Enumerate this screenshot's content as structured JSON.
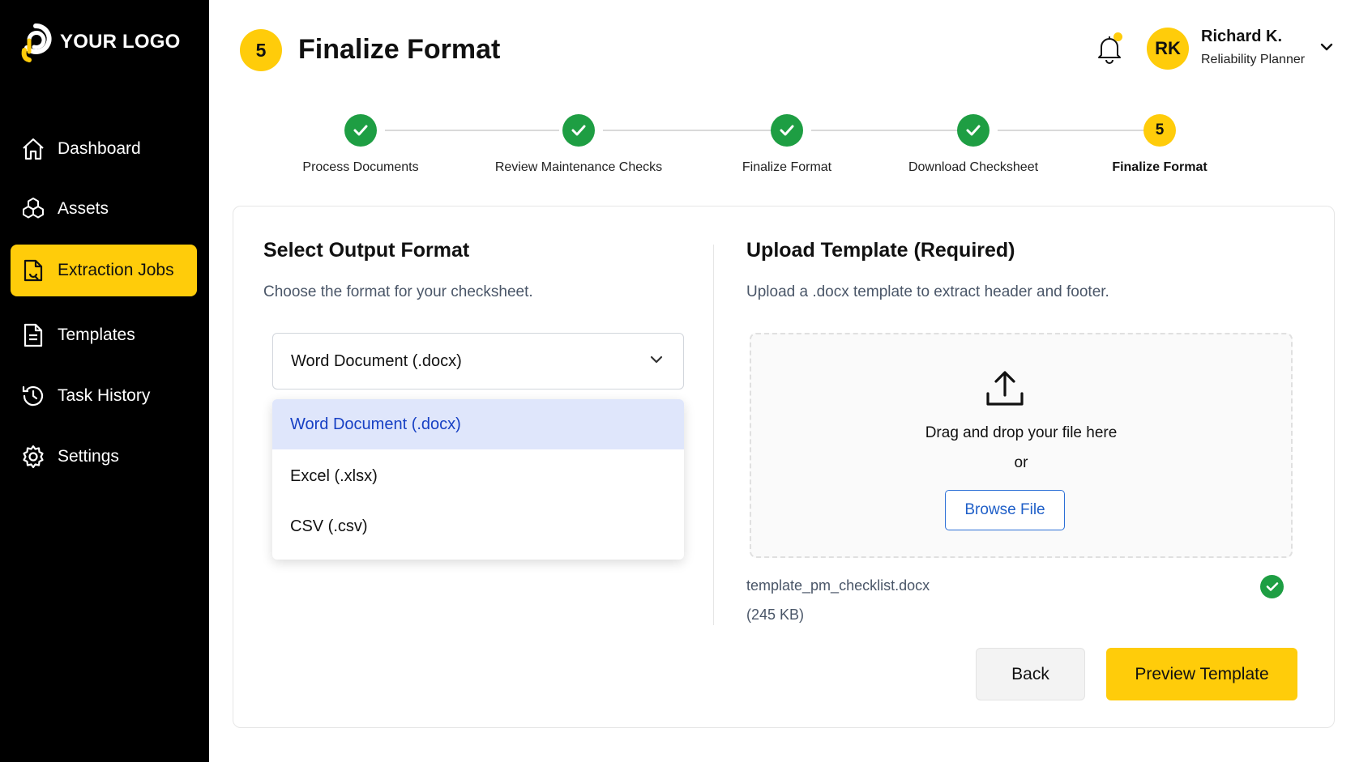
{
  "brand": {
    "logo_text": "YOUR LOGO",
    "accent_color": "#FFCC0A",
    "success_color": "#1e9e43"
  },
  "sidebar": {
    "items": [
      {
        "label": "Dashboard",
        "icon": "home-icon",
        "active": false
      },
      {
        "label": "Assets",
        "icon": "cubes-icon",
        "active": false
      },
      {
        "label": "Extraction Jobs",
        "icon": "document-extract-icon",
        "active": true
      },
      {
        "label": "Templates",
        "icon": "document-icon",
        "active": false
      },
      {
        "label": "Task History",
        "icon": "history-icon",
        "active": false
      },
      {
        "label": "Settings",
        "icon": "gear-icon",
        "active": false
      }
    ]
  },
  "header": {
    "step_number": "5",
    "title": "Finalize Format",
    "notifications": {
      "icon": "bell-icon",
      "has_unread": true
    },
    "user": {
      "initials": "RK",
      "name": "Richard K.",
      "role": "Reliability Planner"
    }
  },
  "stepper": {
    "steps": [
      {
        "label": "Process Documents",
        "status": "complete"
      },
      {
        "label": "Review Maintenance Checks",
        "status": "complete"
      },
      {
        "label": "Finalize Format",
        "status": "complete"
      },
      {
        "label": "Download Checksheet",
        "status": "complete"
      },
      {
        "label": "Finalize Format",
        "status": "current",
        "number": "5"
      }
    ]
  },
  "output_format": {
    "title": "Select Output Format",
    "subtitle": "Choose the format for your checksheet.",
    "selected_value": "Word Document (.docx)",
    "options": [
      "Word Document (.docx)",
      "Excel (.xlsx)",
      "CSV (.csv)"
    ],
    "dropdown_open": true
  },
  "upload": {
    "title": "Upload Template (Required)",
    "subtitle": "Upload a .docx template to extract header and footer.",
    "drop_text": "Drag and drop your file here",
    "or_text": "or",
    "browse_label": "Browse File",
    "file": {
      "name": "template_pm_checklist.docx",
      "size": "(245 KB)",
      "uploaded": true
    }
  },
  "actions": {
    "back_label": "Back",
    "preview_label": "Preview Template"
  }
}
